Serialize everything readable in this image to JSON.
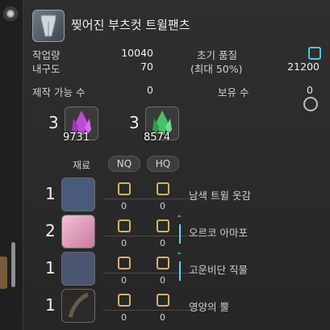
{
  "item": {
    "name": "찢어진 부츠컷 트윌팬츠"
  },
  "stats": {
    "workload_label": "작업량",
    "workload_value": "10040",
    "durability_label": "내구도",
    "durability_value": "70",
    "initial_quality_label": "초기 품질",
    "max_label": "(최대 50%)",
    "quality_value": "21200"
  },
  "craftable": {
    "label": "제작 가능 수",
    "value": "0"
  },
  "owned": {
    "label": "보유 수",
    "value": "0"
  },
  "crystals": [
    {
      "required": "3",
      "count": "9731",
      "color": "#c04bd6"
    },
    {
      "required": "3",
      "count": "8574",
      "color": "#4bc06a"
    }
  ],
  "materials": {
    "header": "재료",
    "nq_label": "NQ",
    "hq_label": "HQ",
    "rows": [
      {
        "qty": "1",
        "name": "남색 트윌 옷감",
        "nq": "0",
        "hq": "0",
        "has_hq_marker": false,
        "color": "#4a5a7a"
      },
      {
        "qty": "2",
        "name": "오르코 아마포",
        "nq": "0",
        "hq": "0",
        "has_hq_marker": true,
        "color": "#e6a6c0"
      },
      {
        "qty": "1",
        "name": "고운비단 직물",
        "nq": "0",
        "hq": "0",
        "has_hq_marker": true,
        "color": "#4a5670"
      },
      {
        "qty": "1",
        "name": "영양의 뿔",
        "nq": "0",
        "hq": "0",
        "has_hq_marker": false,
        "color": "#2c2a28"
      }
    ]
  }
}
